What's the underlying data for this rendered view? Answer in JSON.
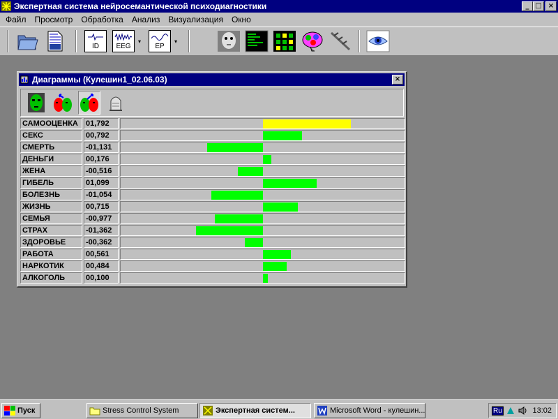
{
  "app": {
    "title": "Экспертная система нейросемантической психодиагностики",
    "window_buttons": {
      "minimize": "_",
      "maximize": "□",
      "close": "×"
    }
  },
  "menu": [
    "Файл",
    "Просмотр",
    "Обработка",
    "Анализ",
    "Визуализация",
    "Окно"
  ],
  "toolbar": {
    "id_label": "ID",
    "eeg_label": "EEG",
    "ep_label": "EP",
    "dropdown_arrow": "▾",
    "icons": [
      "open-folder-icon",
      "document-icon",
      "id-icon",
      "eeg-icon",
      "ep-icon",
      "face-icon",
      "monitor-icon",
      "grid-map-icon",
      "brain-icon",
      "tool-icon",
      "eye-icon"
    ]
  },
  "child_window": {
    "title": "Диаграммы (Кулешин1_02.06.03)",
    "close": "×",
    "tools": [
      "face-green-icon",
      "face-red-swap-icon",
      "face-red-arrow-icon",
      "thimble-icon"
    ]
  },
  "colors": {
    "titlebar": "#000080",
    "positive_bar": "#00ff00",
    "highlight_bar": "#ffff00",
    "face": "#c0c0c0"
  },
  "chart_data": {
    "type": "bar",
    "orientation": "horizontal",
    "zero_line": "center",
    "xlim": [
      -2.0,
      2.0
    ],
    "rows": [
      {
        "label": "САМООЦЕНКА",
        "value_text": "01,792",
        "value": 1.792,
        "color": "#ffff00"
      },
      {
        "label": "СЕКС",
        "value_text": "00,792",
        "value": 0.792,
        "color": "#00ff00"
      },
      {
        "label": "СМЕРТЬ",
        "value_text": "-01,131",
        "value": -1.131,
        "color": "#00ff00"
      },
      {
        "label": "ДЕНЬГИ",
        "value_text": "00,176",
        "value": 0.176,
        "color": "#00ff00"
      },
      {
        "label": "ЖЕНА",
        "value_text": "-00,516",
        "value": -0.516,
        "color": "#00ff00"
      },
      {
        "label": "ГИБЕЛЬ",
        "value_text": "01,099",
        "value": 1.099,
        "color": "#00ff00"
      },
      {
        "label": "БОЛЕЗНЬ",
        "value_text": "-01,054",
        "value": -1.054,
        "color": "#00ff00"
      },
      {
        "label": "ЖИЗНЬ",
        "value_text": "00,715",
        "value": 0.715,
        "color": "#00ff00"
      },
      {
        "label": "СЕМЬЯ",
        "value_text": "-00,977",
        "value": -0.977,
        "color": "#00ff00"
      },
      {
        "label": "СТРАХ",
        "value_text": "-01,362",
        "value": -1.362,
        "color": "#00ff00"
      },
      {
        "label": "ЗДОРОВЬЕ",
        "value_text": "-00,362",
        "value": -0.362,
        "color": "#00ff00"
      },
      {
        "label": "РАБОТА",
        "value_text": "00,561",
        "value": 0.561,
        "color": "#00ff00"
      },
      {
        "label": "НАРКОТИК",
        "value_text": "00,484",
        "value": 0.484,
        "color": "#00ff00"
      },
      {
        "label": "АЛКОГОЛЬ",
        "value_text": "00,100",
        "value": 0.1,
        "color": "#00ff00"
      }
    ]
  },
  "taskbar": {
    "start": "Пуск",
    "tasks": [
      {
        "label": "Stress Control System",
        "active": false
      },
      {
        "label": "Экспертная систем...",
        "active": true
      },
      {
        "label": "Microsoft Word - кулешин....",
        "active": false
      }
    ],
    "tray": {
      "lang": "Ru",
      "time": "13:02"
    }
  }
}
